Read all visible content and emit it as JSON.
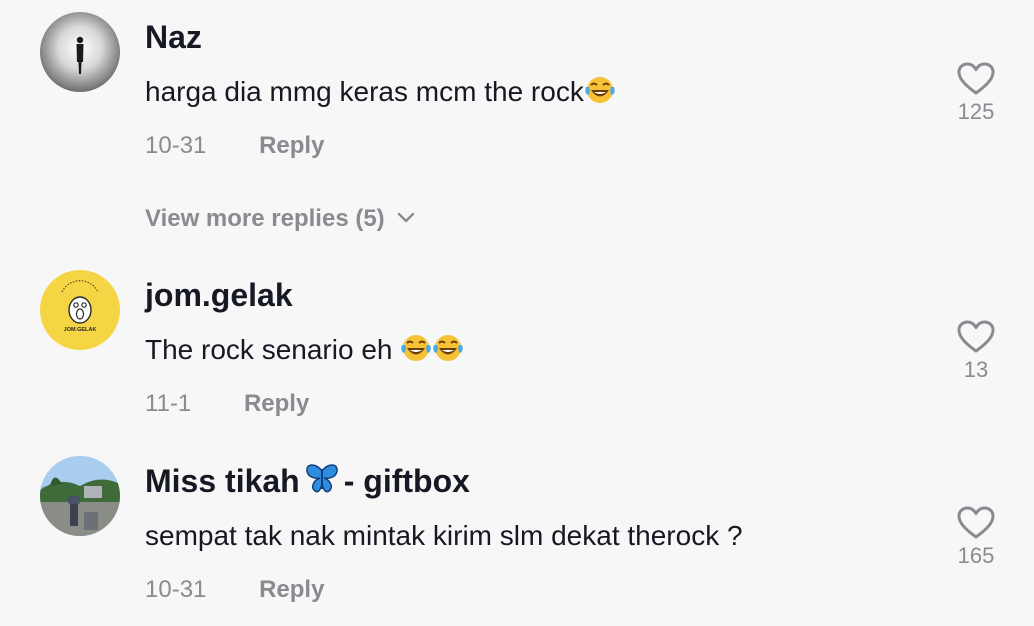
{
  "comments": [
    {
      "username": "Naz",
      "text": "harga dia mmg keras mcm the rock",
      "emojis": [
        "face-with-tears-of-joy"
      ],
      "date": "10-31",
      "reply_label": "Reply",
      "likes": "125"
    },
    {
      "username": "jom.gelak",
      "text": "The rock senario eh ",
      "emojis": [
        "face-with-tears-of-joy",
        "face-with-tears-of-joy"
      ],
      "date": "11-1",
      "reply_label": "Reply",
      "likes": "13",
      "avatar_text": "JOM.GELAK"
    },
    {
      "username_prefix": "Miss tikah",
      "username_suffix": "- giftbox",
      "username_emoji": "butterfly",
      "text": "sempat tak nak mintak kirim slm dekat therock ?",
      "date": "10-31",
      "reply_label": "Reply",
      "likes": "165"
    }
  ],
  "view_more_replies": "View more replies (5)",
  "colors": {
    "background": "#f7f7f7",
    "text_primary": "#161823",
    "text_secondary": "#8a8b91",
    "jom_gelak_avatar": "#f5d544"
  }
}
